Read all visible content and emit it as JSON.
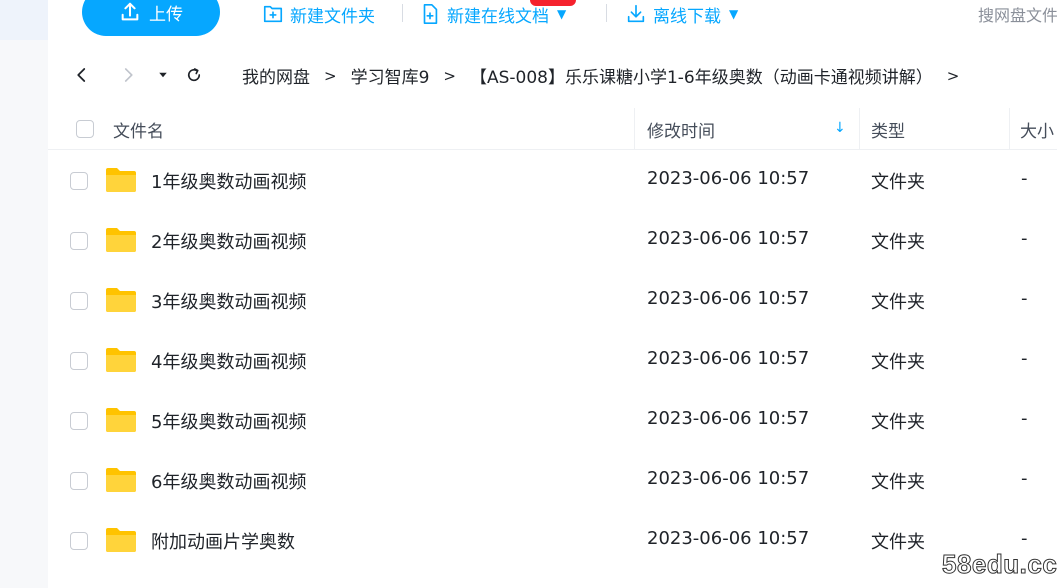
{
  "toolbar": {
    "upload_label": "上传",
    "new_folder_label": "新建文件夹",
    "new_doc_label": "新建在线文档",
    "offline_download_label": "离线下载",
    "search_placeholder": "搜网盘文件"
  },
  "nav": {
    "back_icon": "chevron-left-icon",
    "forward_icon": "chevron-right-icon",
    "history_icon": "dropdown-caret-icon",
    "refresh_icon": "refresh-icon",
    "breadcrumbs": [
      {
        "label": "我的网盘"
      },
      {
        "label": "学习智库9"
      },
      {
        "label": "【AS-008】乐乐课糖小学1-6年级奥数（动画卡通视频讲解）"
      }
    ],
    "separator": ">"
  },
  "table": {
    "columns": {
      "name": "文件名",
      "modified": "修改时间",
      "type": "类型",
      "size": "大小"
    },
    "sort_indicator": "↓",
    "rows": [
      {
        "name": "1年级奥数动画视频",
        "modified": "2023-06-06 10:57",
        "type": "文件夹",
        "size": "-"
      },
      {
        "name": "2年级奥数动画视频",
        "modified": "2023-06-06 10:57",
        "type": "文件夹",
        "size": "-"
      },
      {
        "name": "3年级奥数动画视频",
        "modified": "2023-06-06 10:57",
        "type": "文件夹",
        "size": "-"
      },
      {
        "name": "4年级奥数动画视频",
        "modified": "2023-06-06 10:57",
        "type": "文件夹",
        "size": "-"
      },
      {
        "name": "5年级奥数动画视频",
        "modified": "2023-06-06 10:57",
        "type": "文件夹",
        "size": "-"
      },
      {
        "name": "6年级奥数动画视频",
        "modified": "2023-06-06 10:57",
        "type": "文件夹",
        "size": "-"
      },
      {
        "name": "附加动画片学奥数",
        "modified": "2023-06-06 10:57",
        "type": "文件夹",
        "size": "-"
      }
    ]
  },
  "watermark": "58edu.cc",
  "colors": {
    "accent": "#06a7ff",
    "folder": "#ffd43b",
    "badge": "#f5222d"
  }
}
